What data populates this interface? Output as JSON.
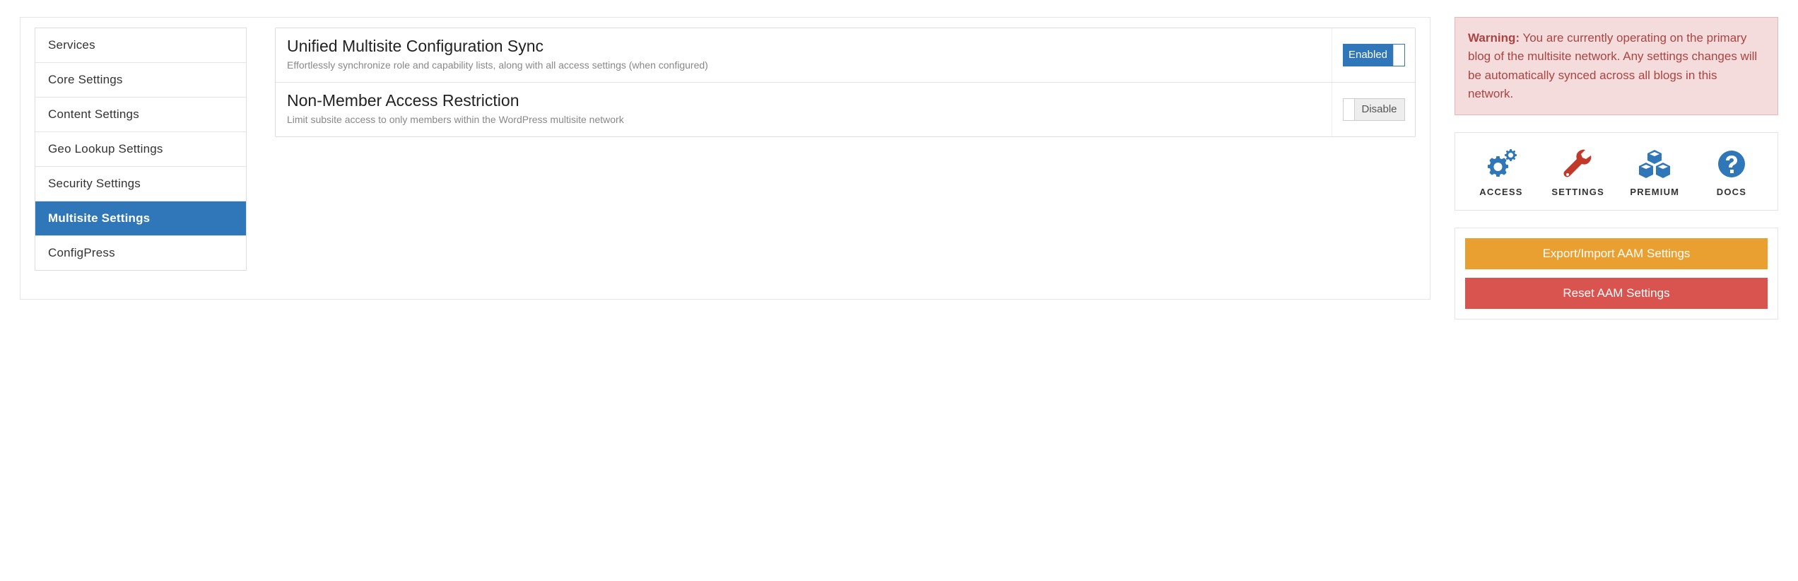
{
  "sidebar": {
    "items": [
      {
        "label": "Services",
        "active": false
      },
      {
        "label": "Core Settings",
        "active": false
      },
      {
        "label": "Content Settings",
        "active": false
      },
      {
        "label": "Geo Lookup Settings",
        "active": false
      },
      {
        "label": "Security Settings",
        "active": false
      },
      {
        "label": "Multisite Settings",
        "active": true
      },
      {
        "label": "ConfigPress",
        "active": false
      }
    ]
  },
  "settings": [
    {
      "title": "Unified Multisite Configuration Sync",
      "desc": "Effortlessly synchronize role and capability lists, along with all access settings (when configured)",
      "toggle": {
        "state": "on",
        "label": "Enabled"
      }
    },
    {
      "title": "Non-Member Access Restriction",
      "desc": "Limit subsite access to only members within the WordPress multisite network",
      "toggle": {
        "state": "off",
        "label": "Disable"
      }
    }
  ],
  "warning": {
    "prefix": "Warning:",
    "text": " You are currently operating on the primary blog of the multisite network. Any settings changes will be automatically synced across all blogs in this network."
  },
  "quicklinks": [
    {
      "label": "ACCESS",
      "icon": "gears",
      "color": "#2f77b8"
    },
    {
      "label": "SETTINGS",
      "icon": "wrench",
      "color": "#c0392b"
    },
    {
      "label": "PREMIUM",
      "icon": "cubes",
      "color": "#2f77b8"
    },
    {
      "label": "DOCS",
      "icon": "question",
      "color": "#2f77b8"
    }
  ],
  "actions": {
    "export_import": "Export/Import AAM Settings",
    "reset": "Reset AAM Settings"
  }
}
